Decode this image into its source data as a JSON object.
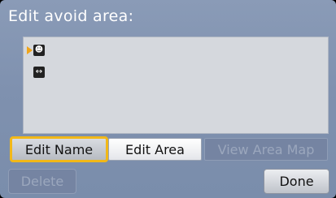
{
  "screen": {
    "title": "Edit avoid area:"
  },
  "list": {
    "rows": [
      {
        "icon": "face-icon",
        "glyph": "☻",
        "selected": true
      },
      {
        "icon": "double-arrow-icon",
        "glyph": "↔",
        "selected": false
      }
    ]
  },
  "buttons": {
    "edit_name": "Edit Name",
    "edit_area": "Edit Area",
    "view_area_map": "View Area Map",
    "delete": "Delete",
    "done": "Done"
  },
  "colors": {
    "background": "#7f91af",
    "highlight": "#f2b818",
    "disabled_text": "#9ba7bd"
  }
}
